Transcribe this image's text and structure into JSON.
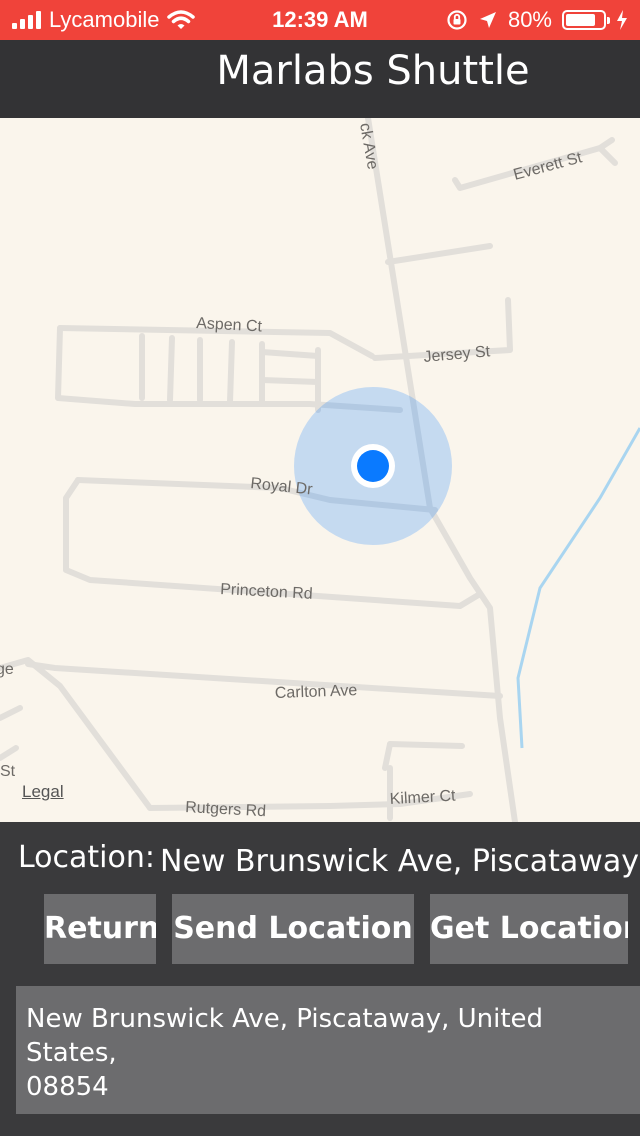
{
  "status_bar": {
    "carrier": "Lycamobile",
    "time": "12:39 AM",
    "battery_percent": "80%",
    "battery_level": 0.8,
    "background": "#f0433a"
  },
  "nav": {
    "title": "Marlabs Shuttle"
  },
  "map": {
    "streets": [
      "ck Ave",
      "Everett St",
      "Aspen Ct",
      "Jersey St",
      "Royal Dr",
      "Princeton Rd",
      "Carlton Ave",
      "Rutgers Rd",
      "Kilmer Ct",
      "St",
      "ge"
    ],
    "legal": "Legal",
    "user_dot_color": "#0a7aff"
  },
  "location": {
    "label": "Location:",
    "value": "New Brunswick Ave, Piscataway"
  },
  "buttons": {
    "return": "Return",
    "send_location": "Send Location",
    "get_location": "Get Location"
  },
  "address": {
    "text": "New Brunswick Ave, Piscataway, United States,\n08854"
  }
}
